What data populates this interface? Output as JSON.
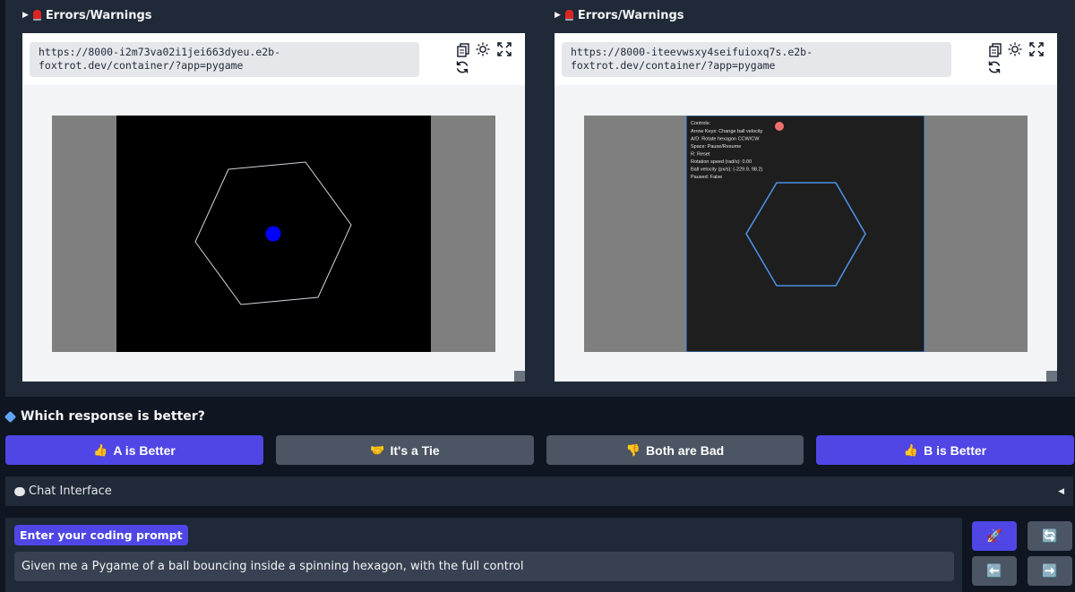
{
  "panel_a": {
    "errors_label": "Errors/Warnings",
    "url_line1": "https://8000-i2m73va02i1jei663dyeu.e2b-",
    "url_line2": "foxtrot.dev/container/?app=pygame"
  },
  "panel_b": {
    "errors_label": "Errors/Warnings",
    "url_line1": "https://8000-iteevwsxy4seifuioxq7s.e2b-",
    "url_line2": "foxtrot.dev/container/?app=pygame",
    "overlay_lines": [
      "Controls:",
      "Arrow Keys: Change ball velocity",
      "A/D: Rotate hexagon CCW/CW",
      "Space: Pause/Resume",
      "R: Reset",
      "Rotation speed (rad/s): 0.00",
      "Ball velocity (px/s): (-229.9, 98.2)",
      "Paused: False"
    ]
  },
  "question": "Which response is better?",
  "votes": {
    "a_better": "A is Better",
    "tie": "It's a Tie",
    "both_bad": "Both are Bad",
    "b_better": "B is Better"
  },
  "chat": {
    "accordion_label": "Chat Interface"
  },
  "prompt": {
    "label": "Enter your coding prompt",
    "value": "Given me a Pygame of a ball bouncing inside a spinning hexagon, with the full control"
  },
  "colors": {
    "primary": "#4f46e5",
    "secondary": "#4b5563",
    "ball_a": "#0000ff",
    "ball_b": "#f07070",
    "hexagon_b": "#4a90e2"
  },
  "icons": {
    "copy": "copy-icon",
    "theme": "sun-icon",
    "fullscreen": "expand-icon",
    "refresh": "refresh-icon",
    "send": "rocket-icon",
    "clear": "cycle-icon",
    "undo": "arrow-left-icon",
    "redo": "arrow-right-icon"
  }
}
